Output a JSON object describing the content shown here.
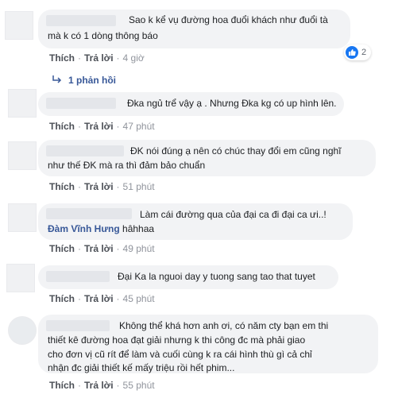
{
  "comments": [
    {
      "lines": [
        "Sao k kể vụ đường hoa đuổi khách như đuổi tà",
        "mà k có 1 dòng thông báo"
      ],
      "like": "Thích",
      "reply": "Trả lời",
      "time": "4 giờ",
      "reactions": "2",
      "reaction_icon": "like-icon"
    },
    {
      "replies_label": "1 phản hồi"
    },
    {
      "lines": [
        "Đka ngủ trể vậy ạ . Nhưng Đka kg có up hình lên."
      ],
      "like": "Thích",
      "reply": "Trả lời",
      "time": "47 phút"
    },
    {
      "lines": [
        "ĐK nói đúng ạ nên có chúc thay đổi em cũng nghĩ",
        "như thế ĐK mà ra thì đảm bảo chuẩn"
      ],
      "like": "Thích",
      "reply": "Trả lời",
      "time": "51 phút"
    },
    {
      "lines": [
        "Làm cái đường qua của đại ca đi đại ca ưi..!"
      ],
      "mention": "Đàm Vĩnh Hưng",
      "after_mention": " hâhhaa",
      "like": "Thích",
      "reply": "Trả lời",
      "time": "49 phút"
    },
    {
      "lines": [
        "Đại Ka la nguoi day y tuong sang tao that tuyet"
      ],
      "like": "Thích",
      "reply": "Trả lời",
      "time": "45 phút"
    },
    {
      "lines": [
        "Không thể khá hơn anh ơi, có năm cty bạn em thi",
        "thiết kê đường hoa đạt giải nhưng k thi công đc mà phải giao",
        "cho đơn vị cũ rít để làm và cuối cùng k ra cái hình thù gì cả chỉ",
        "nhận đc giải thiết kế mấy triệu rồi hết phim..."
      ],
      "like": "Thích",
      "reply": "Trả lời",
      "time": "55 phút"
    }
  ],
  "colors": {
    "link": "#385898",
    "bubble": "#f2f3f5",
    "meta": "#90949c",
    "like_blue": "#1877f2"
  }
}
